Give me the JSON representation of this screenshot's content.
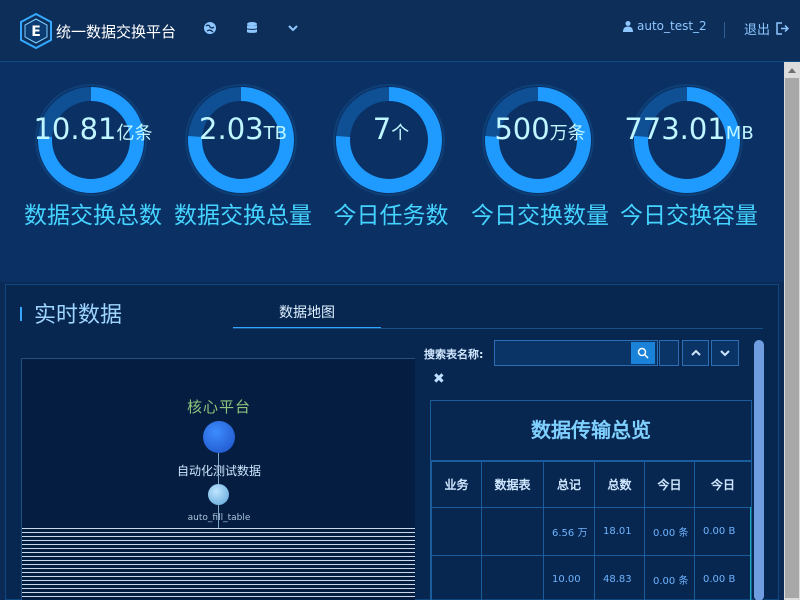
{
  "header": {
    "app_title": "统一数据交换平台",
    "username": "auto_test_2",
    "logout_label": "退出",
    "icons": [
      "globe-icon",
      "database-icon",
      "chevron-down-icon",
      "user-icon",
      "logout-icon"
    ]
  },
  "stats": [
    {
      "num": "10.81",
      "unit": "亿条",
      "label": "数据交换总数"
    },
    {
      "num": "2.03",
      "unit": "TB",
      "label": "数据交换总量"
    },
    {
      "num": "7",
      "unit": "个",
      "label": "今日任务数"
    },
    {
      "num": "500",
      "unit": "万条",
      "label": "今日交换数量"
    },
    {
      "num": "773.01",
      "unit": "MB",
      "label": "今日交换容量"
    }
  ],
  "realtime": {
    "title": "实时数据",
    "tab_label": "数据地图",
    "map": {
      "platform_label": "核心平台",
      "source_label": "自动化测试数据",
      "table_label": "auto_fill_table"
    },
    "search_label": "搜索表名称:",
    "search_value": "",
    "overview": {
      "title": "数据传输总览",
      "columns": [
        "业务",
        "数据表",
        "总记",
        "总数",
        "今日",
        "今日"
      ],
      "rows": [
        [
          "",
          "",
          "6.56 万",
          "18.01",
          "0.00 条",
          "0.00 B"
        ],
        [
          "",
          "",
          "10.00",
          "48.83",
          "0.00 条",
          "0.00 B"
        ]
      ]
    }
  },
  "colors": {
    "accent": "#45d4ff",
    "ring": "#1f9bff",
    "background": "#0a2a55"
  }
}
